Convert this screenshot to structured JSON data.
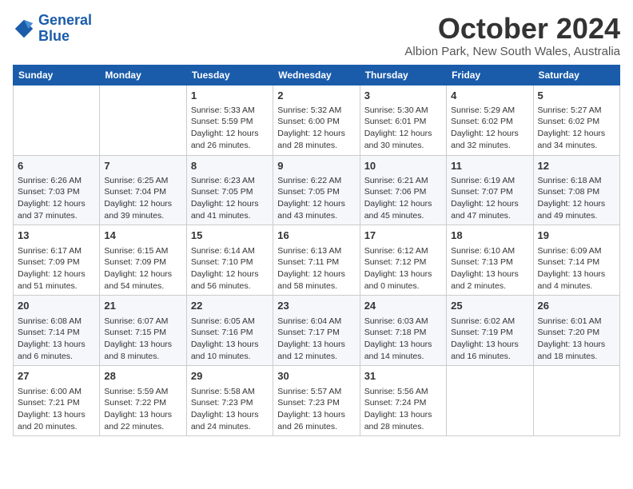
{
  "logo": {
    "line1": "General",
    "line2": "Blue"
  },
  "title": "October 2024",
  "subtitle": "Albion Park, New South Wales, Australia",
  "days_of_week": [
    "Sunday",
    "Monday",
    "Tuesday",
    "Wednesday",
    "Thursday",
    "Friday",
    "Saturday"
  ],
  "weeks": [
    [
      {
        "day": "",
        "sunrise": "",
        "sunset": "",
        "daylight": ""
      },
      {
        "day": "",
        "sunrise": "",
        "sunset": "",
        "daylight": ""
      },
      {
        "day": "1",
        "sunrise": "Sunrise: 5:33 AM",
        "sunset": "Sunset: 5:59 PM",
        "daylight": "Daylight: 12 hours and 26 minutes."
      },
      {
        "day": "2",
        "sunrise": "Sunrise: 5:32 AM",
        "sunset": "Sunset: 6:00 PM",
        "daylight": "Daylight: 12 hours and 28 minutes."
      },
      {
        "day": "3",
        "sunrise": "Sunrise: 5:30 AM",
        "sunset": "Sunset: 6:01 PM",
        "daylight": "Daylight: 12 hours and 30 minutes."
      },
      {
        "day": "4",
        "sunrise": "Sunrise: 5:29 AM",
        "sunset": "Sunset: 6:02 PM",
        "daylight": "Daylight: 12 hours and 32 minutes."
      },
      {
        "day": "5",
        "sunrise": "Sunrise: 5:27 AM",
        "sunset": "Sunset: 6:02 PM",
        "daylight": "Daylight: 12 hours and 34 minutes."
      }
    ],
    [
      {
        "day": "6",
        "sunrise": "Sunrise: 6:26 AM",
        "sunset": "Sunset: 7:03 PM",
        "daylight": "Daylight: 12 hours and 37 minutes."
      },
      {
        "day": "7",
        "sunrise": "Sunrise: 6:25 AM",
        "sunset": "Sunset: 7:04 PM",
        "daylight": "Daylight: 12 hours and 39 minutes."
      },
      {
        "day": "8",
        "sunrise": "Sunrise: 6:23 AM",
        "sunset": "Sunset: 7:05 PM",
        "daylight": "Daylight: 12 hours and 41 minutes."
      },
      {
        "day": "9",
        "sunrise": "Sunrise: 6:22 AM",
        "sunset": "Sunset: 7:05 PM",
        "daylight": "Daylight: 12 hours and 43 minutes."
      },
      {
        "day": "10",
        "sunrise": "Sunrise: 6:21 AM",
        "sunset": "Sunset: 7:06 PM",
        "daylight": "Daylight: 12 hours and 45 minutes."
      },
      {
        "day": "11",
        "sunrise": "Sunrise: 6:19 AM",
        "sunset": "Sunset: 7:07 PM",
        "daylight": "Daylight: 12 hours and 47 minutes."
      },
      {
        "day": "12",
        "sunrise": "Sunrise: 6:18 AM",
        "sunset": "Sunset: 7:08 PM",
        "daylight": "Daylight: 12 hours and 49 minutes."
      }
    ],
    [
      {
        "day": "13",
        "sunrise": "Sunrise: 6:17 AM",
        "sunset": "Sunset: 7:09 PM",
        "daylight": "Daylight: 12 hours and 51 minutes."
      },
      {
        "day": "14",
        "sunrise": "Sunrise: 6:15 AM",
        "sunset": "Sunset: 7:09 PM",
        "daylight": "Daylight: 12 hours and 54 minutes."
      },
      {
        "day": "15",
        "sunrise": "Sunrise: 6:14 AM",
        "sunset": "Sunset: 7:10 PM",
        "daylight": "Daylight: 12 hours and 56 minutes."
      },
      {
        "day": "16",
        "sunrise": "Sunrise: 6:13 AM",
        "sunset": "Sunset: 7:11 PM",
        "daylight": "Daylight: 12 hours and 58 minutes."
      },
      {
        "day": "17",
        "sunrise": "Sunrise: 6:12 AM",
        "sunset": "Sunset: 7:12 PM",
        "daylight": "Daylight: 13 hours and 0 minutes."
      },
      {
        "day": "18",
        "sunrise": "Sunrise: 6:10 AM",
        "sunset": "Sunset: 7:13 PM",
        "daylight": "Daylight: 13 hours and 2 minutes."
      },
      {
        "day": "19",
        "sunrise": "Sunrise: 6:09 AM",
        "sunset": "Sunset: 7:14 PM",
        "daylight": "Daylight: 13 hours and 4 minutes."
      }
    ],
    [
      {
        "day": "20",
        "sunrise": "Sunrise: 6:08 AM",
        "sunset": "Sunset: 7:14 PM",
        "daylight": "Daylight: 13 hours and 6 minutes."
      },
      {
        "day": "21",
        "sunrise": "Sunrise: 6:07 AM",
        "sunset": "Sunset: 7:15 PM",
        "daylight": "Daylight: 13 hours and 8 minutes."
      },
      {
        "day": "22",
        "sunrise": "Sunrise: 6:05 AM",
        "sunset": "Sunset: 7:16 PM",
        "daylight": "Daylight: 13 hours and 10 minutes."
      },
      {
        "day": "23",
        "sunrise": "Sunrise: 6:04 AM",
        "sunset": "Sunset: 7:17 PM",
        "daylight": "Daylight: 13 hours and 12 minutes."
      },
      {
        "day": "24",
        "sunrise": "Sunrise: 6:03 AM",
        "sunset": "Sunset: 7:18 PM",
        "daylight": "Daylight: 13 hours and 14 minutes."
      },
      {
        "day": "25",
        "sunrise": "Sunrise: 6:02 AM",
        "sunset": "Sunset: 7:19 PM",
        "daylight": "Daylight: 13 hours and 16 minutes."
      },
      {
        "day": "26",
        "sunrise": "Sunrise: 6:01 AM",
        "sunset": "Sunset: 7:20 PM",
        "daylight": "Daylight: 13 hours and 18 minutes."
      }
    ],
    [
      {
        "day": "27",
        "sunrise": "Sunrise: 6:00 AM",
        "sunset": "Sunset: 7:21 PM",
        "daylight": "Daylight: 13 hours and 20 minutes."
      },
      {
        "day": "28",
        "sunrise": "Sunrise: 5:59 AM",
        "sunset": "Sunset: 7:22 PM",
        "daylight": "Daylight: 13 hours and 22 minutes."
      },
      {
        "day": "29",
        "sunrise": "Sunrise: 5:58 AM",
        "sunset": "Sunset: 7:23 PM",
        "daylight": "Daylight: 13 hours and 24 minutes."
      },
      {
        "day": "30",
        "sunrise": "Sunrise: 5:57 AM",
        "sunset": "Sunset: 7:23 PM",
        "daylight": "Daylight: 13 hours and 26 minutes."
      },
      {
        "day": "31",
        "sunrise": "Sunrise: 5:56 AM",
        "sunset": "Sunset: 7:24 PM",
        "daylight": "Daylight: 13 hours and 28 minutes."
      },
      {
        "day": "",
        "sunrise": "",
        "sunset": "",
        "daylight": ""
      },
      {
        "day": "",
        "sunrise": "",
        "sunset": "",
        "daylight": ""
      }
    ]
  ]
}
